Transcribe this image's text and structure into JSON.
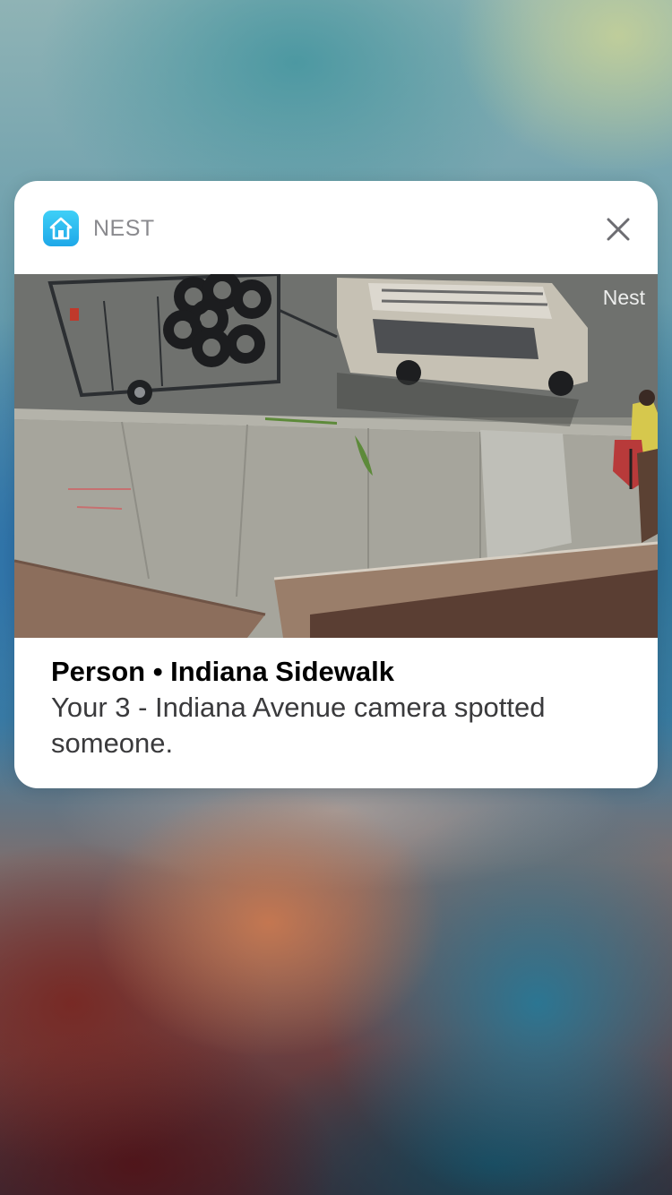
{
  "notification": {
    "app_name": "NEST",
    "app_icon": "home-icon",
    "close_icon": "close-icon",
    "snapshot": {
      "watermark": "Nest"
    },
    "title": "Person • Indiana Sidewalk",
    "message": "Your 3 - Indiana Avenue camera spotted someone."
  },
  "colors": {
    "app_icon_accent": "#1ea8e8",
    "app_name_text": "#8a8a8e",
    "title_text": "#000000",
    "message_text": "#3a3a3c",
    "card_background": "#ffffff"
  }
}
